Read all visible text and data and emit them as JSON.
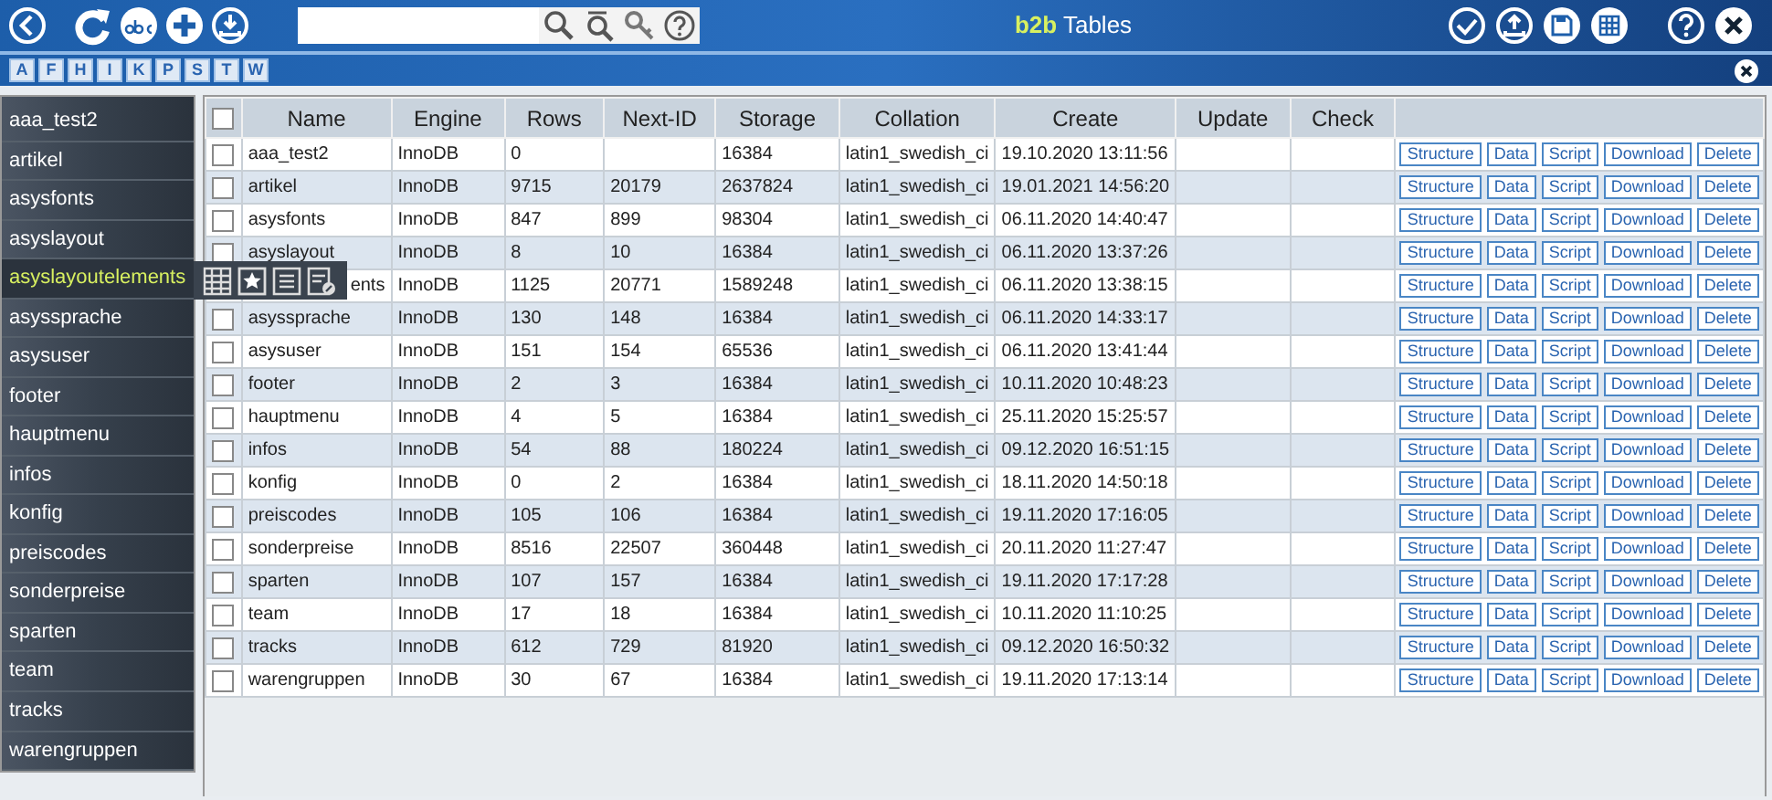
{
  "header": {
    "brand": "b2b",
    "title": "Tables"
  },
  "letters": [
    "A",
    "F",
    "H",
    "I",
    "K",
    "P",
    "S",
    "T",
    "W"
  ],
  "sidebar": {
    "items": [
      {
        "label": "aaa_test2",
        "selected": false
      },
      {
        "label": "artikel",
        "selected": false
      },
      {
        "label": "asysfonts",
        "selected": false
      },
      {
        "label": "asyslayout",
        "selected": false
      },
      {
        "label": "asyslayoutelements",
        "selected": true
      },
      {
        "label": "asyssprache",
        "selected": false
      },
      {
        "label": "asysuser",
        "selected": false
      },
      {
        "label": "footer",
        "selected": false
      },
      {
        "label": "hauptmenu",
        "selected": false
      },
      {
        "label": "infos",
        "selected": false
      },
      {
        "label": "konfig",
        "selected": false
      },
      {
        "label": "preiscodes",
        "selected": false
      },
      {
        "label": "sonderpreise",
        "selected": false
      },
      {
        "label": "sparten",
        "selected": false
      },
      {
        "label": "team",
        "selected": false
      },
      {
        "label": "tracks",
        "selected": false
      },
      {
        "label": "warengruppen",
        "selected": false
      }
    ]
  },
  "table": {
    "select_all_checked": false,
    "columns": [
      "Name",
      "Engine",
      "Rows",
      "Next-ID",
      "Storage",
      "Collation",
      "Create",
      "Update",
      "Check"
    ],
    "rows": [
      {
        "kind": "row",
        "checked": false,
        "name": "aaa_test2",
        "engine": "InnoDB",
        "rows": "0",
        "storage": "16384",
        "collation": "latin1_swedish_ci",
        "create": "19.10.2020 13:11:56",
        "actions": [
          "Structure",
          "Data",
          "Script",
          "Download",
          "Delete"
        ]
      },
      {
        "kind": "row",
        "checked": false,
        "name": "artikel",
        "engine": "InnoDB",
        "rows": "9715",
        "next_id": "20179",
        "storage": "2637824",
        "collation": "latin1_swedish_ci",
        "create": "19.01.2021 14:56:20",
        "actions": [
          "Structure",
          "Data",
          "Script",
          "Download",
          "Delete"
        ]
      },
      {
        "kind": "row",
        "checked": false,
        "name": "asysfonts",
        "engine": "InnoDB",
        "rows": "847",
        "next_id": "899",
        "storage": "98304",
        "collation": "latin1_swedish_ci",
        "create": "06.11.2020 14:40:47",
        "actions": [
          "Structure",
          "Data",
          "Script",
          "Download",
          "Delete"
        ]
      },
      {
        "kind": "row",
        "checked": false,
        "name": "asyslayout",
        "engine": "InnoDB",
        "rows": "8",
        "next_id": "10",
        "storage": "16384",
        "collation": "latin1_swedish_ci",
        "create": "06.11.2020 13:37:26",
        "actions": [
          "Structure",
          "Data",
          "Script",
          "Download",
          "Delete"
        ]
      },
      {
        "kind": "covered",
        "name": "ents",
        "engine": "InnoDB",
        "rows": "1125",
        "next_id": "20771",
        "storage": "1589248",
        "collation": "latin1_swedish_ci",
        "create": "06.11.2020 13:38:15",
        "actions": [
          "Structure",
          "Data",
          "Script",
          "Download",
          "Delete"
        ]
      },
      {
        "kind": "row",
        "checked": false,
        "name": "asyssprache",
        "engine": "InnoDB",
        "rows": "130",
        "next_id": "148",
        "storage": "16384",
        "collation": "latin1_swedish_ci",
        "create": "06.11.2020 14:33:17",
        "actions": [
          "Structure",
          "Data",
          "Script",
          "Download",
          "Delete"
        ]
      },
      {
        "kind": "row",
        "checked": false,
        "name": "asysuser",
        "engine": "InnoDB",
        "rows": "151",
        "next_id": "154",
        "storage": "65536",
        "collation": "latin1_swedish_ci",
        "create": "06.11.2020 13:41:44",
        "actions": [
          "Structure",
          "Data",
          "Script",
          "Download",
          "Delete"
        ]
      },
      {
        "kind": "row",
        "checked": false,
        "name": "footer",
        "engine": "InnoDB",
        "rows": "2",
        "next_id": "3",
        "storage": "16384",
        "collation": "latin1_swedish_ci",
        "create": "10.11.2020 10:48:23",
        "actions": [
          "Structure",
          "Data",
          "Script",
          "Download",
          "Delete"
        ]
      },
      {
        "kind": "row",
        "checked": false,
        "name": "hauptmenu",
        "engine": "InnoDB",
        "rows": "4",
        "next_id": "5",
        "storage": "16384",
        "collation": "latin1_swedish_ci",
        "create": "25.11.2020 15:25:57",
        "actions": [
          "Structure",
          "Data",
          "Script",
          "Download",
          "Delete"
        ]
      },
      {
        "kind": "row",
        "checked": false,
        "name": "infos",
        "engine": "InnoDB",
        "rows": "54",
        "next_id": "88",
        "storage": "180224",
        "collation": "latin1_swedish_ci",
        "create": "09.12.2020 16:51:15",
        "actions": [
          "Structure",
          "Data",
          "Script",
          "Download",
          "Delete"
        ]
      },
      {
        "kind": "row",
        "checked": false,
        "name": "konfig",
        "engine": "InnoDB",
        "rows": "0",
        "next_id": "2",
        "storage": "16384",
        "collation": "latin1_swedish_ci",
        "create": "18.11.2020 14:50:18",
        "actions": [
          "Structure",
          "Data",
          "Script",
          "Download",
          "Delete"
        ]
      },
      {
        "kind": "row",
        "checked": false,
        "name": "preiscodes",
        "engine": "InnoDB",
        "rows": "105",
        "next_id": "106",
        "storage": "16384",
        "collation": "latin1_swedish_ci",
        "create": "19.11.2020 17:16:05",
        "actions": [
          "Structure",
          "Data",
          "Script",
          "Download",
          "Delete"
        ]
      },
      {
        "kind": "row",
        "checked": false,
        "name": "sonderpreise",
        "engine": "InnoDB",
        "rows": "8516",
        "next_id": "22507",
        "storage": "360448",
        "collation": "latin1_swedish_ci",
        "create": "20.11.2020 11:27:47",
        "actions": [
          "Structure",
          "Data",
          "Script",
          "Download",
          "Delete"
        ]
      },
      {
        "kind": "row",
        "checked": false,
        "name": "sparten",
        "engine": "InnoDB",
        "rows": "107",
        "next_id": "157",
        "storage": "16384",
        "collation": "latin1_swedish_ci",
        "create": "19.11.2020 17:17:28",
        "actions": [
          "Structure",
          "Data",
          "Script",
          "Download",
          "Delete"
        ]
      },
      {
        "kind": "row",
        "checked": false,
        "name": "team",
        "engine": "InnoDB",
        "rows": "17",
        "next_id": "18",
        "storage": "16384",
        "collation": "latin1_swedish_ci",
        "create": "10.11.2020 11:10:25",
        "actions": [
          "Structure",
          "Data",
          "Script",
          "Download",
          "Delete"
        ]
      },
      {
        "kind": "row",
        "checked": false,
        "name": "tracks",
        "engine": "InnoDB",
        "rows": "612",
        "next_id": "729",
        "storage": "81920",
        "collation": "latin1_swedish_ci",
        "create": "09.12.2020 16:50:32",
        "actions": [
          "Structure",
          "Data",
          "Script",
          "Download",
          "Delete"
        ]
      },
      {
        "kind": "row",
        "checked": false,
        "name": "warengruppen",
        "engine": "InnoDB",
        "rows": "30",
        "next_id": "67",
        "storage": "16384",
        "collation": "latin1_swedish_ci",
        "create": "19.11.2020 17:13:14",
        "actions": [
          "Structure",
          "Data",
          "Script",
          "Download",
          "Delete"
        ]
      }
    ]
  }
}
